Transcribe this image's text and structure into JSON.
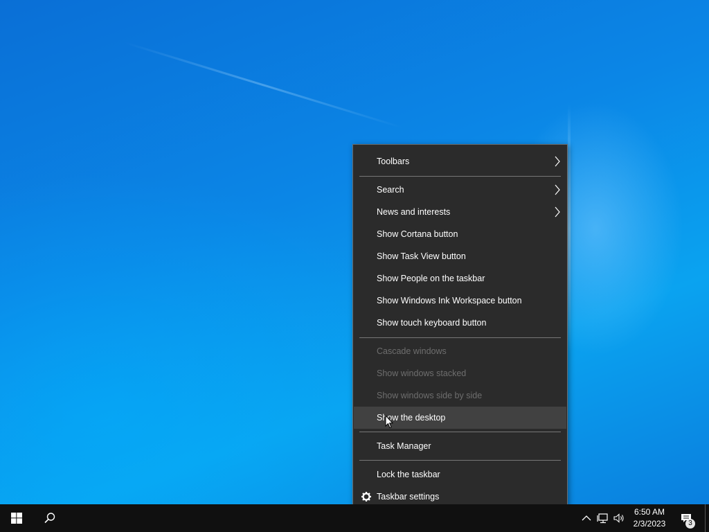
{
  "context_menu": {
    "items": [
      {
        "label": "Toolbars",
        "submenu": true,
        "enabled": true
      },
      {
        "label": "Search",
        "submenu": true,
        "enabled": true
      },
      {
        "label": "News and interests",
        "submenu": true,
        "enabled": true
      },
      {
        "label": "Show Cortana button",
        "enabled": true
      },
      {
        "label": "Show Task View button",
        "enabled": true
      },
      {
        "label": "Show People on the taskbar",
        "enabled": true
      },
      {
        "label": "Show Windows Ink Workspace button",
        "enabled": true
      },
      {
        "label": "Show touch keyboard button",
        "enabled": true
      },
      {
        "label": "Cascade windows",
        "enabled": false
      },
      {
        "label": "Show windows stacked",
        "enabled": false
      },
      {
        "label": "Show windows side by side",
        "enabled": false
      },
      {
        "label": "Show the desktop",
        "enabled": true,
        "hovered": true
      },
      {
        "label": "Task Manager",
        "enabled": true
      },
      {
        "label": "Lock the taskbar",
        "enabled": true
      },
      {
        "label": "Taskbar settings",
        "enabled": true,
        "icon": "gear-icon"
      }
    ]
  },
  "taskbar": {
    "clock": {
      "time": "6:50 AM",
      "date": "2/3/2023"
    },
    "notification_count": "3",
    "icons": [
      "windows-start-icon",
      "search-icon",
      "chevron-up-icon",
      "network-icon",
      "volume-icon",
      "action-center-icon"
    ]
  },
  "colors": {
    "menu_bg": "#2b2b2b",
    "taskbar_bg": "#101010",
    "disabled_text": "#6e6e6e"
  }
}
